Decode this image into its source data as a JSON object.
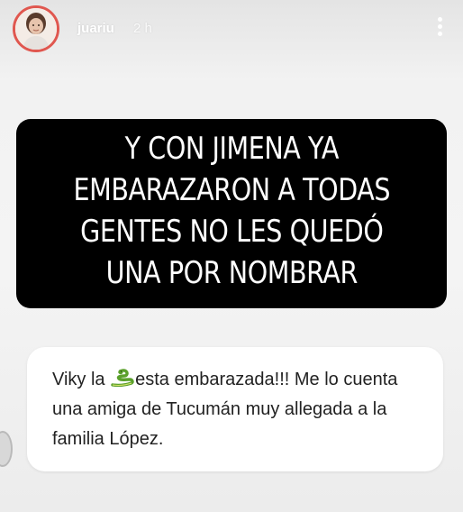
{
  "header": {
    "username": "juariu",
    "timestamp": "2 h",
    "avatar_icon": "profile-photo",
    "more_icon": "more-vertical-icon"
  },
  "caption": {
    "lines": [
      "Y CON JIMENA YA",
      "EMBARAZARON A TODAS",
      "GENTES NO LES QUEDÓ",
      "UNA POR NOMBRAR"
    ]
  },
  "question": {
    "text_before_icon": "Viky la ",
    "icon": "snake-emoji",
    "text_after_icon": "esta embarazada!!! Me lo cuenta una amiga de Tucumán muy allegada a la familia López."
  },
  "colors": {
    "avatar_ring": "#e0574f",
    "caption_bg": "#000000",
    "caption_text": "#ffffff",
    "card_bg": "#ffffff",
    "page_bg": "#ececec"
  }
}
